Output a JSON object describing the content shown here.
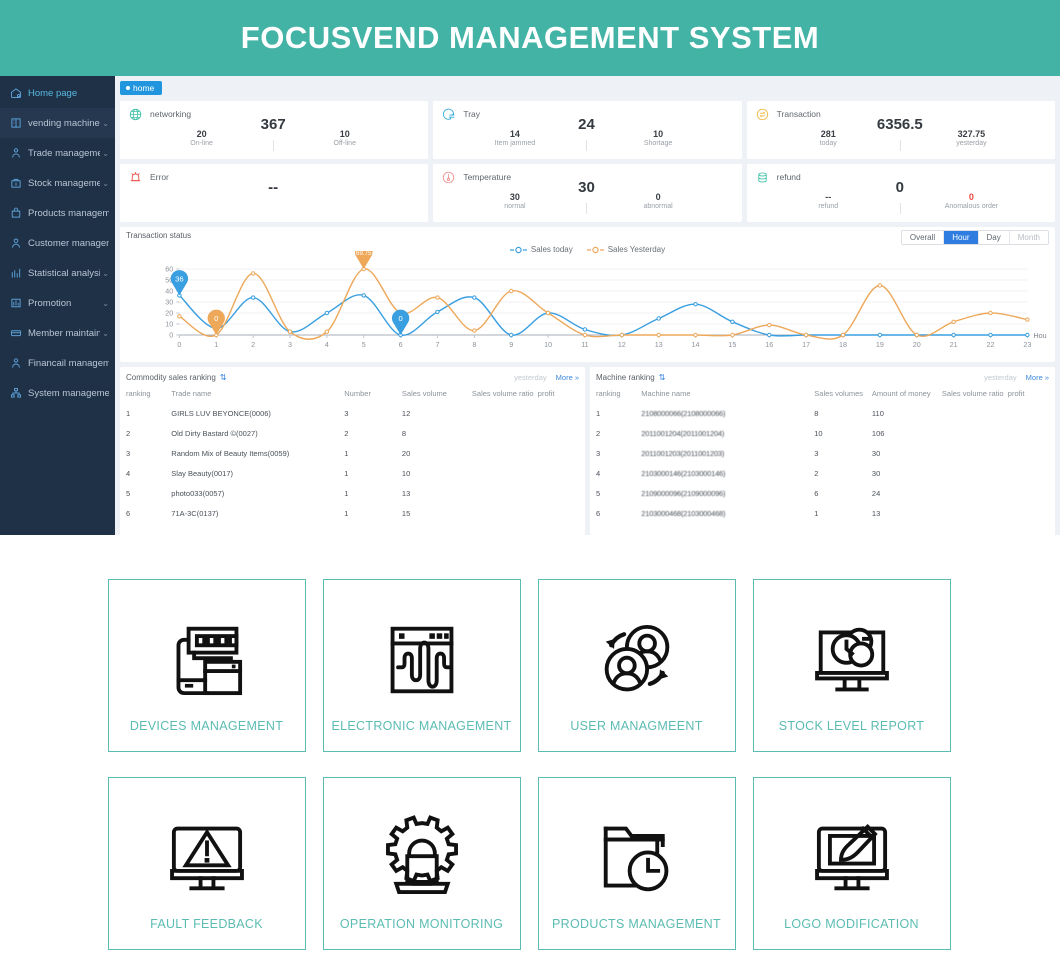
{
  "header": {
    "title": "FOCUSVEND MANAGEMENT SYSTEM"
  },
  "sidebar": {
    "items": [
      {
        "label": "Home page",
        "icon": "home-icon",
        "caret": "",
        "active": true,
        "highlight": false
      },
      {
        "label": "vending machine",
        "icon": "machine-icon",
        "caret": "⌄",
        "active": false,
        "highlight": true
      },
      {
        "label": "Trade management",
        "icon": "trade-icon",
        "caret": "⌄",
        "active": false,
        "highlight": false
      },
      {
        "label": "Stock management",
        "icon": "stock-icon",
        "caret": "⌄",
        "active": false,
        "highlight": false
      },
      {
        "label": "Products management",
        "icon": "products-icon",
        "caret": "",
        "active": false,
        "highlight": false
      },
      {
        "label": "Customer management",
        "icon": "customer-icon",
        "caret": "",
        "active": false,
        "highlight": false
      },
      {
        "label": "Statistical analysis",
        "icon": "statistics-icon",
        "caret": "⌄",
        "active": false,
        "highlight": false
      },
      {
        "label": "Promotion",
        "icon": "promotion-icon",
        "caret": "⌄",
        "active": false,
        "highlight": false
      },
      {
        "label": "Member maintain",
        "icon": "member-icon",
        "caret": "⌄",
        "active": false,
        "highlight": false
      },
      {
        "label": "Financail management",
        "icon": "finance-icon",
        "caret": "",
        "active": false,
        "highlight": false
      },
      {
        "label": "System management",
        "icon": "system-icon",
        "caret": "",
        "active": false,
        "highlight": false
      }
    ]
  },
  "tabs": [
    {
      "label": "home",
      "active": true
    }
  ],
  "stat_cards": [
    {
      "title": "networking",
      "icon": "globe-icon",
      "icon_color": "#3fc1a7",
      "big": "367",
      "left": {
        "value": "20",
        "label": "On-line"
      },
      "right": {
        "value": "10",
        "label": "Off-line"
      }
    },
    {
      "title": "Tray",
      "icon": "tray-icon",
      "icon_color": "#2fa8d8",
      "big": "24",
      "left": {
        "value": "14",
        "label": "Item jammed"
      },
      "right": {
        "value": "10",
        "label": "Shortage"
      }
    },
    {
      "title": "Transaction",
      "icon": "transaction-icon",
      "icon_color": "#f0b83d",
      "big": "6356.5",
      "left": {
        "value": "281",
        "label": "today"
      },
      "right": {
        "value": "327.75",
        "label": "yesterday"
      }
    },
    {
      "title": "Error",
      "icon": "alarm-icon",
      "icon_color": "#e8483f",
      "big": "--",
      "left": {
        "value": "",
        "label": ""
      },
      "right": {
        "value": "",
        "label": ""
      }
    },
    {
      "title": "Temperature",
      "icon": "thermometer-icon",
      "icon_color": "#ee8f8b",
      "big": "30",
      "left": {
        "value": "30",
        "label": "normal"
      },
      "right": {
        "value": "0",
        "label": "abnormal"
      }
    },
    {
      "title": "refund",
      "icon": "refund-icon",
      "icon_color": "#3fc1a7",
      "big": "0",
      "left": {
        "value": "--",
        "label": "refund"
      },
      "right": {
        "value": "0",
        "label": "Anomalous order",
        "value_color": "#e8483f"
      }
    }
  ],
  "chart_panel": {
    "title": "Transaction status",
    "range_buttons": [
      {
        "label": "Overall",
        "state": "normal"
      },
      {
        "label": "Hour",
        "state": "active"
      },
      {
        "label": "Day",
        "state": "normal"
      },
      {
        "label": "Month",
        "state": "disabled"
      }
    ],
    "markers": [
      {
        "text": "36",
        "color": "#3a9fe0"
      },
      {
        "text": "0",
        "color": "#f0a03c"
      },
      {
        "text": "69.75",
        "color": "#f0a03c"
      },
      {
        "text": "0",
        "color": "#3a9fe0"
      }
    ]
  },
  "chart_data": {
    "type": "line",
    "title": "Transaction status",
    "xlabel": "Hou",
    "ylabel": "",
    "xlim": [
      0,
      23
    ],
    "ylim": [
      0,
      60
    ],
    "yticks": [
      0,
      10,
      20,
      30,
      40,
      50,
      60
    ],
    "x": [
      0,
      1,
      2,
      3,
      4,
      5,
      6,
      7,
      8,
      9,
      10,
      11,
      12,
      13,
      14,
      15,
      16,
      17,
      18,
      19,
      20,
      21,
      22,
      23
    ],
    "grid": true,
    "legend_position": "top-center",
    "series": [
      {
        "name": "Sales today",
        "color": "#3a9fe0",
        "values": [
          36,
          6,
          34,
          3,
          20,
          36,
          0,
          21,
          34,
          0,
          20,
          5,
          0,
          15,
          28,
          12,
          0,
          0,
          0,
          0,
          0,
          0,
          0,
          0
        ]
      },
      {
        "name": "Sales Yesterday",
        "color": "#eda85a",
        "values": [
          17,
          0,
          56,
          3,
          3,
          60,
          20,
          34,
          4,
          40,
          20,
          0,
          0,
          0,
          0,
          0,
          9,
          0,
          0,
          45,
          0,
          12,
          20,
          14
        ]
      }
    ],
    "annotations": [
      {
        "series": "Sales today",
        "x": 0,
        "value": 36,
        "label": "36"
      },
      {
        "series": "Sales Yesterday",
        "x": 1,
        "value": 0,
        "label": "0"
      },
      {
        "series": "Sales Yesterday",
        "x": 5,
        "value": 69.75,
        "label": "69.75"
      },
      {
        "series": "Sales today",
        "x": 6,
        "value": 0,
        "label": "0"
      }
    ]
  },
  "commodity_ranking": {
    "title": "Commodity sales ranking",
    "sort_icon": "sort-icon",
    "period_label": "yesterday",
    "more_label": "More »",
    "columns": [
      "ranking",
      "Trade name",
      "Number",
      "Sales volume",
      "Sales volume ratio",
      "profit"
    ],
    "rows": [
      [
        "1",
        "GIRLS LUV BEYONCE(0006)",
        "3",
        "12",
        "",
        ""
      ],
      [
        "2",
        "Old Dirty Bastard ©(0027)",
        "2",
        "8",
        "",
        ""
      ],
      [
        "3",
        "Random Mix of Beauty Items(0059)",
        "1",
        "20",
        "",
        ""
      ],
      [
        "4",
        "Slay Beauty(0017)",
        "1",
        "10",
        "",
        ""
      ],
      [
        "5",
        "photo033(0057)",
        "1",
        "13",
        "",
        ""
      ],
      [
        "6",
        "71A-3C(0137)",
        "1",
        "15",
        "",
        ""
      ]
    ]
  },
  "machine_ranking": {
    "title": "Machine ranking",
    "sort_icon": "sort-icon",
    "period_label": "yesterday",
    "more_label": "More »",
    "columns": [
      "ranking",
      "Machine name",
      "Sales volumes",
      "Amount of money",
      "Sales volume ratio",
      "profit"
    ],
    "rows": [
      [
        "1",
        "2108000066(2108000066)",
        "8",
        "110",
        "",
        ""
      ],
      [
        "2",
        "2011001204(2011001204)",
        "10",
        "106",
        "",
        ""
      ],
      [
        "3",
        "2011001203(2011001203)",
        "3",
        "30",
        "",
        ""
      ],
      [
        "4",
        "2103000146(2103000146)",
        "2",
        "30",
        "",
        ""
      ],
      [
        "5",
        "2109000096(2109000096)",
        "6",
        "24",
        "",
        ""
      ],
      [
        "6",
        "2103000468(2103000468)",
        "1",
        "13",
        "",
        ""
      ]
    ]
  },
  "modules": [
    {
      "label": "DEVICES MANAGEMENT",
      "icon": "devices-icon"
    },
    {
      "label": "ELECTRONIC MANAGEMENT",
      "icon": "waveform-window-icon"
    },
    {
      "label": "USER MANAGMEENT",
      "icon": "users-sync-icon"
    },
    {
      "label": "STOCK LEVEL REPORT",
      "icon": "monitor-chart-icon"
    },
    {
      "label": "FAULT FEEDBACK",
      "icon": "monitor-warning-icon"
    },
    {
      "label": "OPERATION MONITORING",
      "icon": "gear-laptop-icon"
    },
    {
      "label": "PRODUCTS MANAGEMENT",
      "icon": "folder-clock-icon"
    },
    {
      "label": "LOGO MODIFICATION",
      "icon": "monitor-brush-icon"
    }
  ],
  "colors": {
    "brand_teal": "#42b3a5",
    "card_border": "#5bbcb2",
    "sidebar_bg": "#1f3147",
    "accent_blue": "#2f7de1",
    "series_today": "#3a9fe0",
    "series_yesterday": "#eda85a",
    "danger": "#e8483f"
  }
}
